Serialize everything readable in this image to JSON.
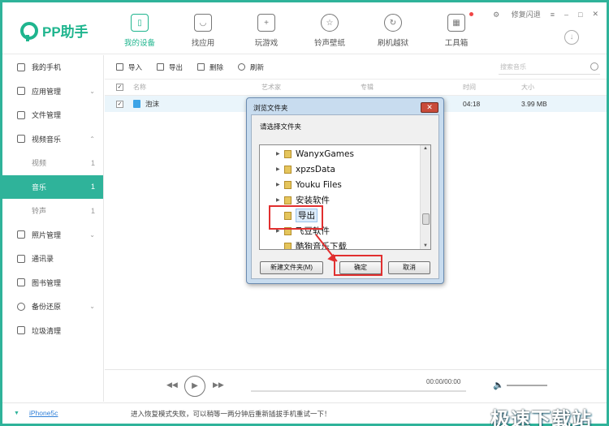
{
  "app": {
    "name": "PP助手"
  },
  "nav": [
    {
      "label": "我的设备",
      "icon": "phone-icon",
      "active": true
    },
    {
      "label": "找应用",
      "icon": "bag-icon"
    },
    {
      "label": "玩游戏",
      "icon": "gamepad-icon"
    },
    {
      "label": "铃声壁纸",
      "icon": "star-icon"
    },
    {
      "label": "刷机越狱",
      "icon": "refresh-icon"
    },
    {
      "label": "工具箱",
      "icon": "toolbox-icon",
      "badge": true
    }
  ],
  "window": {
    "repair_label": "修复闪退",
    "menu_icon": "≡",
    "min_icon": "–",
    "max_icon": "□",
    "close_icon": "✕"
  },
  "sidebar": {
    "items": [
      {
        "label": "我的手机"
      },
      {
        "label": "应用管理",
        "chevron": "⌄"
      },
      {
        "label": "文件管理"
      },
      {
        "label": "视频音乐",
        "chevron": "⌃"
      },
      {
        "label": "视频",
        "count": "1"
      },
      {
        "label": "音乐",
        "count": "1"
      },
      {
        "label": "铃声",
        "count": "1"
      },
      {
        "label": "照片管理",
        "chevron": "⌄"
      },
      {
        "label": "通讯录"
      },
      {
        "label": "图书管理"
      },
      {
        "label": "备份还原",
        "chevron": "⌄"
      },
      {
        "label": "垃圾清理"
      }
    ]
  },
  "toolbar": {
    "import": "导入",
    "export": "导出",
    "delete": "删除",
    "refresh": "刷新",
    "search_placeholder": "搜索音乐"
  },
  "table": {
    "headers": {
      "name": "名称",
      "artist": "艺术家",
      "album": "专辑",
      "time": "时间",
      "size": "大小"
    },
    "rows": [
      {
        "name": "泡沫",
        "time": "04:18",
        "size": "3.99 MB"
      }
    ]
  },
  "player": {
    "time": "00:00/00:00"
  },
  "status": {
    "device": "iPhone5c",
    "message": "进入恢复模式失败，可以稍等一两分钟后重新插拔手机重试一下！"
  },
  "watermark": "极速下载站",
  "dialog": {
    "title": "浏览文件夹",
    "close": "✕",
    "prompt": "请选择文件夹",
    "folders": [
      "WanyxGames",
      "xpzsData",
      "Youku Files",
      "安装软件",
      "导出",
      "飞豆软件",
      "酷狗音乐下载"
    ],
    "new_folder": "新建文件夹(M)",
    "ok": "确定",
    "cancel": "取消"
  }
}
